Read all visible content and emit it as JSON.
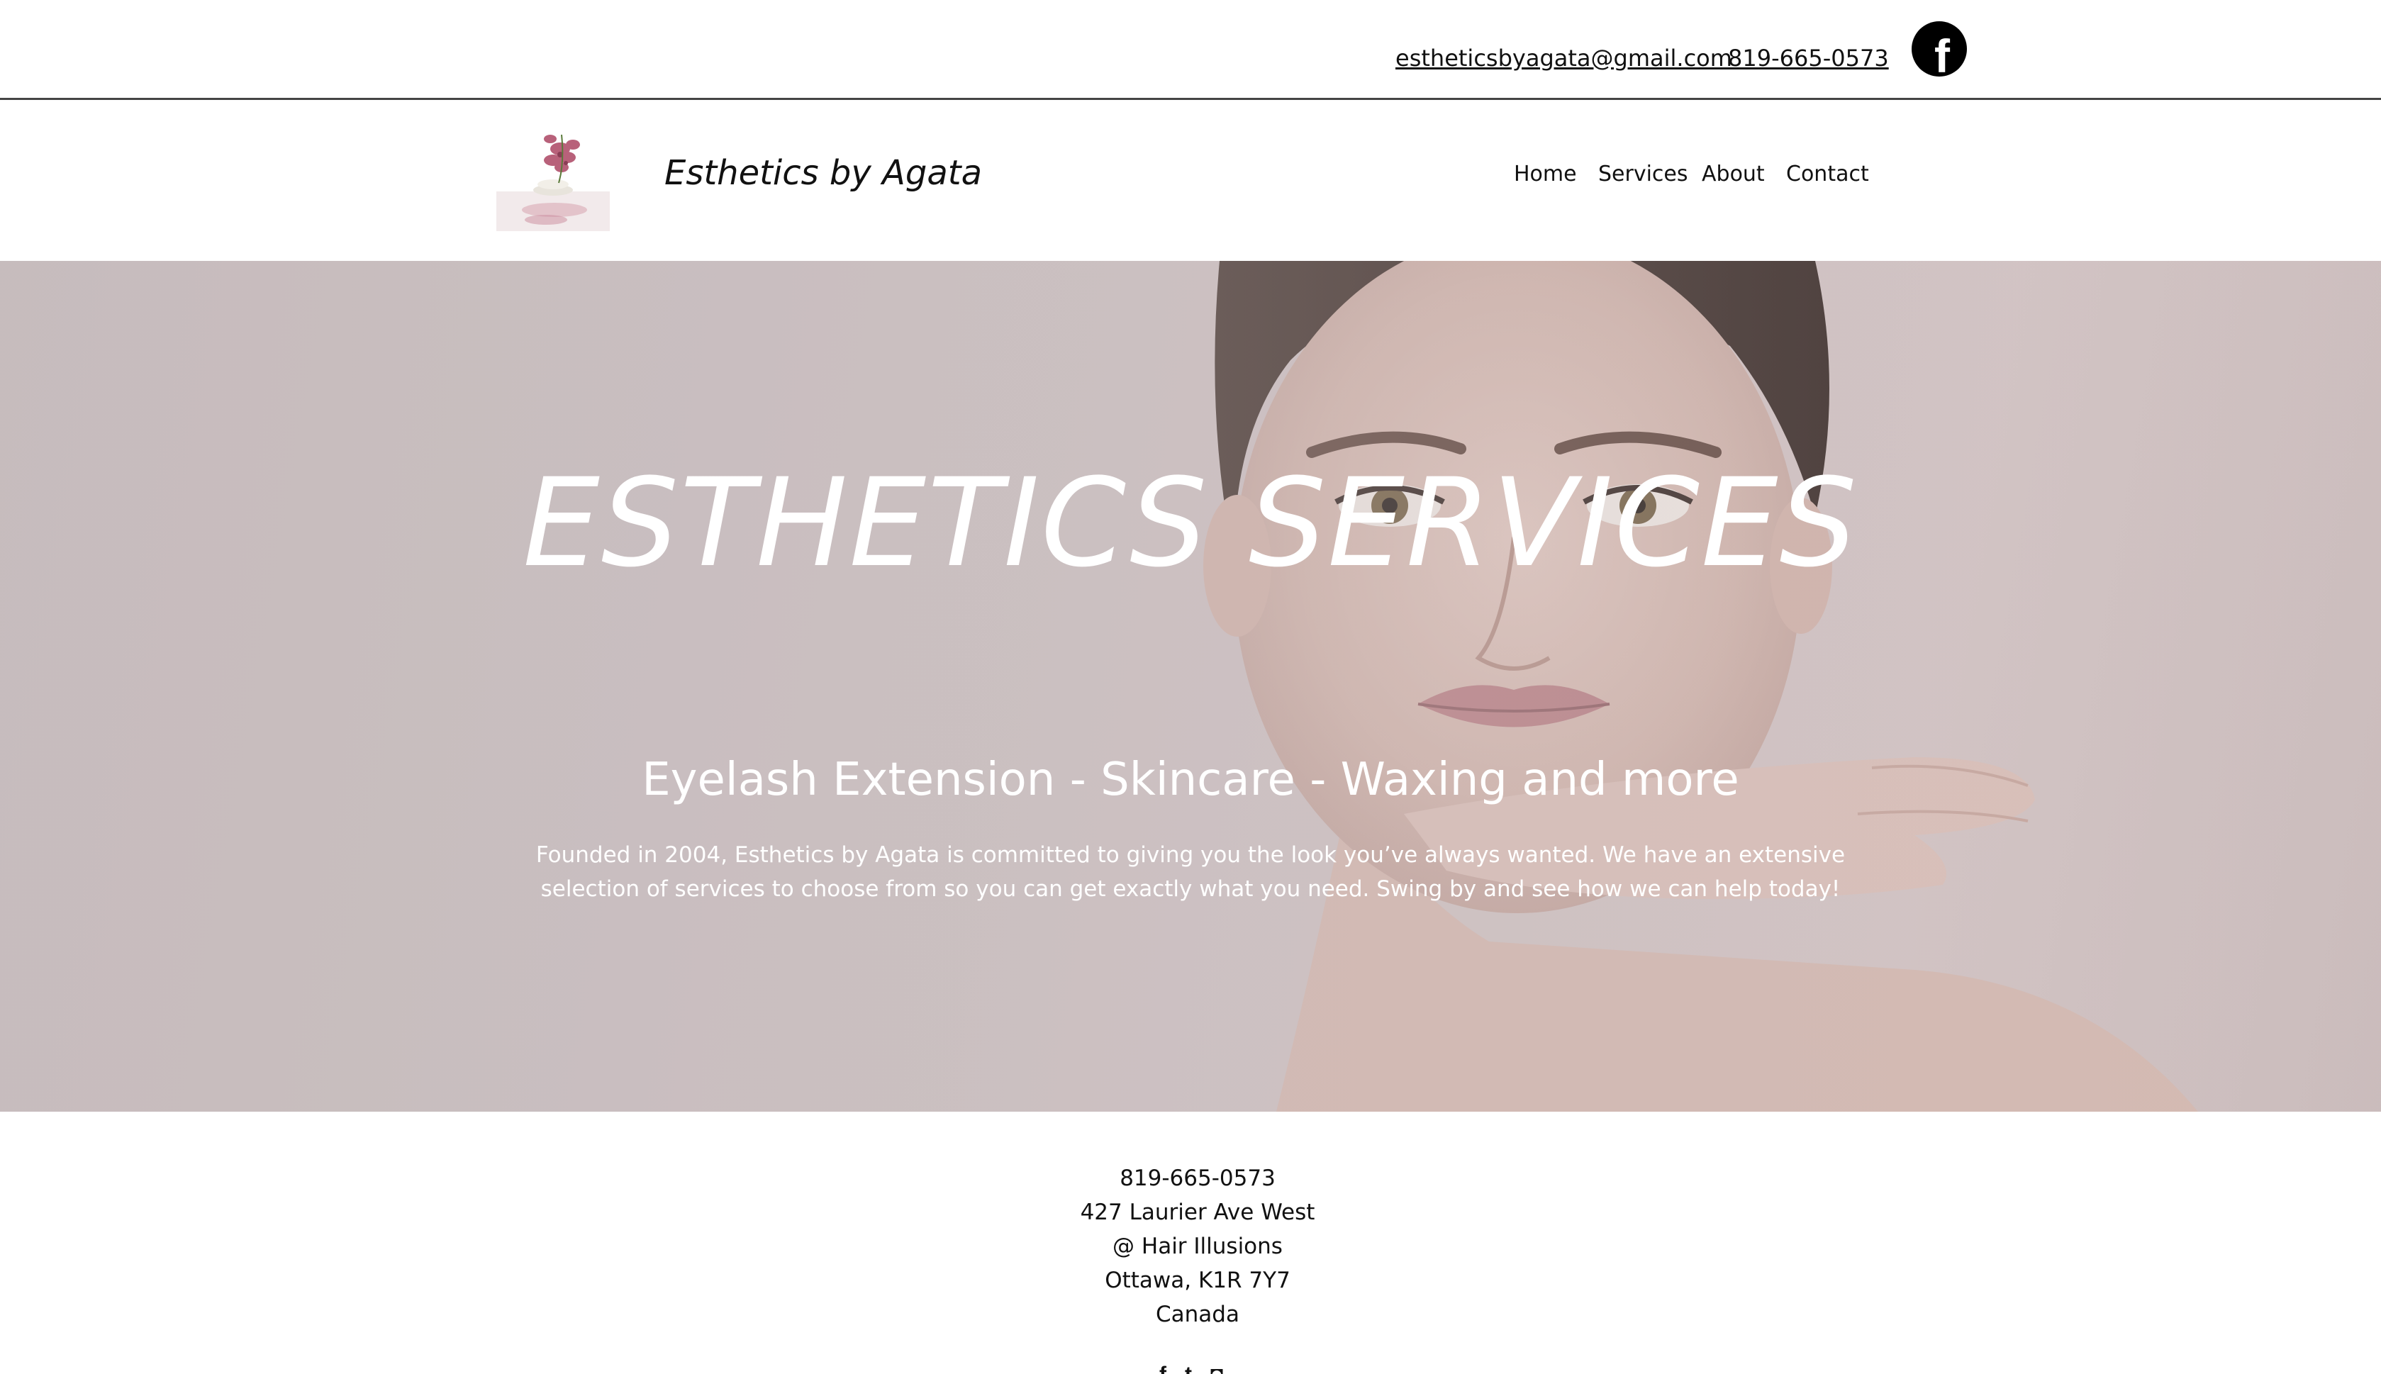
{
  "topbar": {
    "email": "estheticsbyagata@gmail.com",
    "phone": "819-665-0573",
    "facebook_icon": "facebook-icon"
  },
  "header": {
    "logo_icon": "orchid-spa-logo",
    "brand": "Esthetics by Agata",
    "nav": {
      "home": "Home",
      "services": "Services",
      "about": "About",
      "contact": "Contact"
    }
  },
  "hero": {
    "title": "ESTHETICS SERVICES",
    "subtitle": "Eyelash Extension - Skincare - Waxing and more",
    "description": "Founded in 2004, Esthetics by Agata is committed to giving you the look you’ve always wanted. We have an extensive selection of services to choose from so you can get exactly what you need. Swing by and see how we can help today!"
  },
  "footer": {
    "phone": "819-665-0573",
    "address_line1": "427 Laurier Ave West",
    "address_line2": "@ Hair Illusions",
    "address_line3": "Ottawa, K1R 7Y7",
    "address_line4": "Canada",
    "social_icons": [
      "facebook-icon",
      "twitter-icon",
      "instagram-icon"
    ]
  },
  "colors": {
    "hero_bg": "#c9bebf",
    "text": "#111111",
    "hero_text": "#ffffff"
  }
}
